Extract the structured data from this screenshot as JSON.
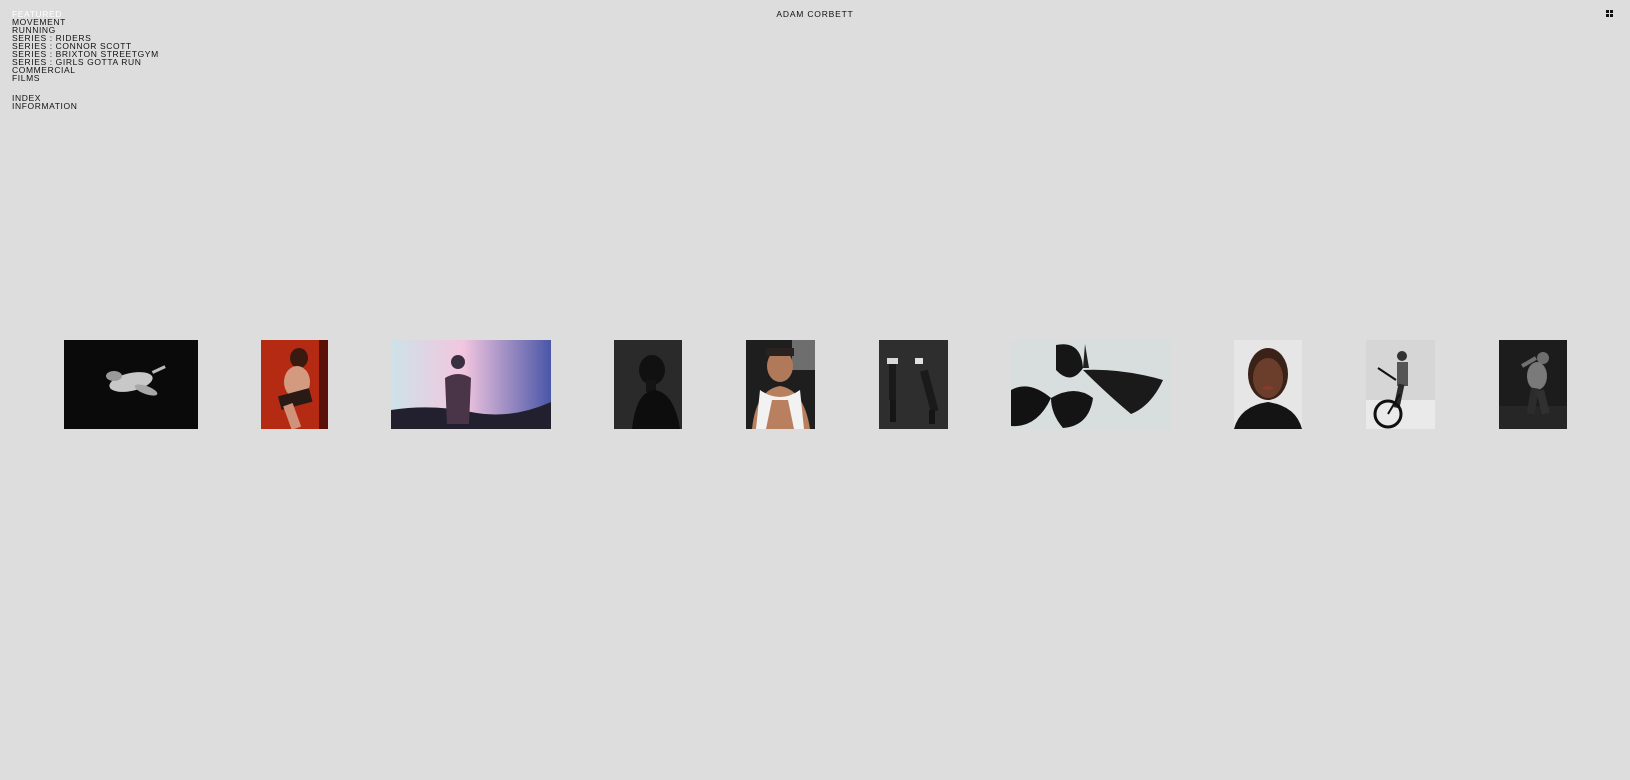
{
  "site": {
    "title": "ADAM CORBETT"
  },
  "nav": {
    "primary": [
      {
        "label": "FEATURED",
        "active": true
      },
      {
        "label": "MOVEMENT"
      },
      {
        "label": "RUNNING"
      },
      {
        "label": "SERIES : RIDERS"
      },
      {
        "label": "SERIES : CONNOR SCOTT"
      },
      {
        "label": "SERIES : BRIXTON STREETGYM"
      },
      {
        "label": "SERIES : GIRLS GOTTA RUN"
      },
      {
        "label": "COMMERCIAL"
      },
      {
        "label": "FILMS"
      }
    ],
    "secondary": [
      {
        "label": "INDEX"
      },
      {
        "label": "INFORMATION"
      }
    ]
  },
  "toolbar": {
    "grid_icon": "grid-icon"
  },
  "gallery": {
    "thumbnails": [
      {
        "name": "thumb-dancer-floating-black"
      },
      {
        "name": "thumb-man-red-wall"
      },
      {
        "name": "thumb-figure-light-flare"
      },
      {
        "name": "thumb-profile-hooded"
      },
      {
        "name": "thumb-smiling-man-towel"
      },
      {
        "name": "thumb-handstand-pair"
      },
      {
        "name": "thumb-black-petals"
      },
      {
        "name": "thumb-woman-portrait"
      },
      {
        "name": "thumb-rider-bicycle"
      },
      {
        "name": "thumb-man-dark-pose"
      }
    ]
  },
  "colors": {
    "background": "#dddddd",
    "text": "#111111",
    "active_nav": "#ffffff"
  }
}
